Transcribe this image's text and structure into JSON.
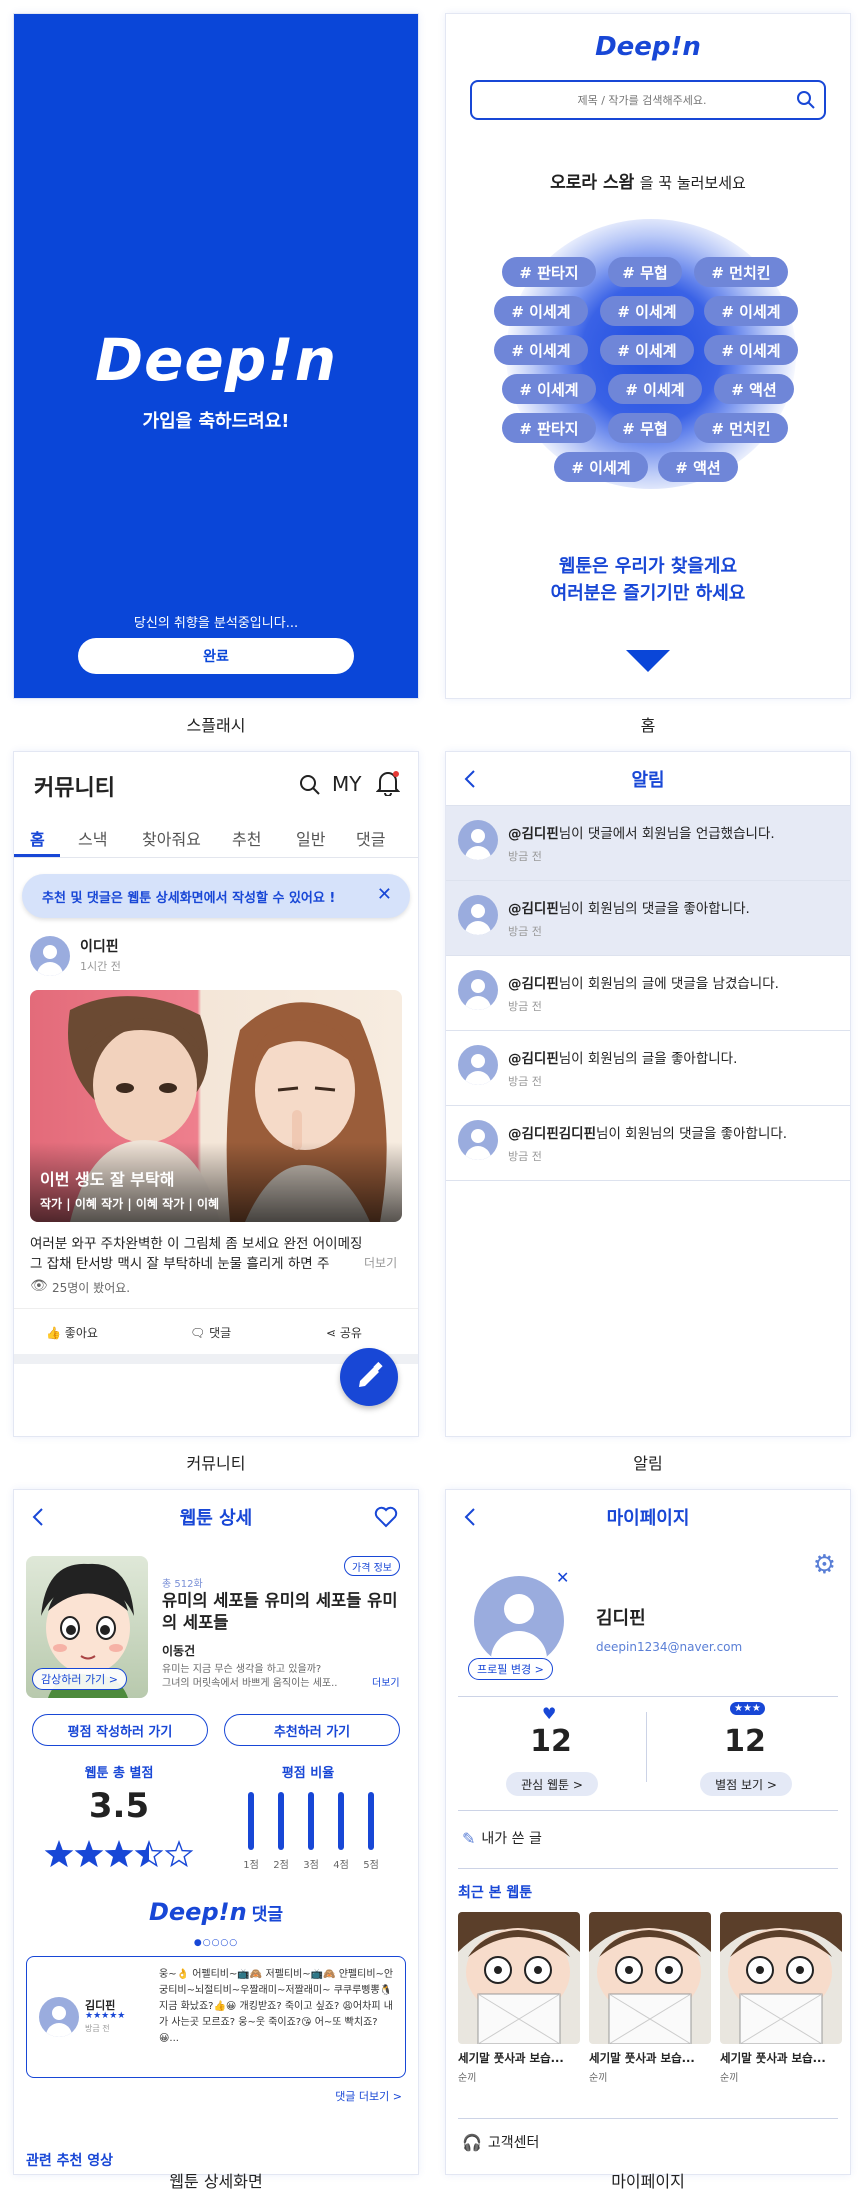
{
  "brand": "Deep!n",
  "splash": {
    "welcome": "가입을 축하드려요!",
    "analyzing": "당신의 취향을 분석중입니다...",
    "done_button": "완료",
    "caption": "스플래시"
  },
  "home": {
    "search_placeholder": "제목 / 작가를 검색해주세요.",
    "prompt_name": "오로라 스왐",
    "prompt_rest": "을 꾹 눌러보세요",
    "tags": [
      "# 판타지",
      "# 무협",
      "# 먼치킨",
      "# 이세계",
      "# 이세계",
      "# 이세계",
      "# 이세계",
      "# 이세계",
      "# 이세계",
      "# 이세계",
      "# 이세계",
      "# 액션",
      "# 판타지",
      "# 무협",
      "# 먼치킨",
      "# 이세계",
      "# 액션"
    ],
    "slogan1": "웹툰은 우리가 찾을게요",
    "slogan2": "여러분은 즐기기만 하세요",
    "caption": "홈"
  },
  "community": {
    "title": "커뮤니티",
    "my": "MY",
    "tabs": [
      "홈",
      "스낵",
      "찾아줘요",
      "추천",
      "일반",
      "댓글"
    ],
    "notice": "추천 및 댓글은 웹툰 상세화면에서 작성할 수 있어요 !",
    "post": {
      "author": "이디핀",
      "time": "1시간 전",
      "image_title": "이번 생도 잘 부탁해",
      "image_meta": "작가 | 이혜  작가 | 이혜  작가 | 이혜",
      "body1": "여러분 와꾸 주차완벽한 이 그림체 좀 보세요 완전 어이메징",
      "body2": "그 잡채 탄서방 맥시 잘 부탁하네 눈물 흘리게 하면 주",
      "more": "더보기",
      "views": "25명이 봤어요."
    },
    "actions": {
      "like": "좋아요",
      "comment": "댓글",
      "share": "공유"
    },
    "caption": "커뮤니티"
  },
  "alarm": {
    "title": "알림",
    "items": [
      {
        "name": "@김디핀",
        "text": "님이 댓글에서 회원님을 언급했습니다.",
        "time": "방금 전",
        "highlight": true
      },
      {
        "name": "@김디핀",
        "text": "님이 회원님의 댓글을 좋아합니다.",
        "time": "방금 전",
        "highlight": true
      },
      {
        "name": "@김디핀",
        "text": "님이 회원님의 글에 댓글을 남겼습니다.",
        "time": "방금 전",
        "highlight": false
      },
      {
        "name": "@김디핀",
        "text": "님이 회원님의 글을 좋아합니다.",
        "time": "방금 전",
        "highlight": false
      },
      {
        "name": "@김디핀김디핀",
        "text": "님이 회원님의 댓글을 좋아합니다.",
        "time": "방금 전",
        "highlight": false
      }
    ],
    "caption": "알림"
  },
  "detail": {
    "title": "웹툰 상세",
    "price_info": "가격 정보",
    "episodes": "총 512화",
    "webtoon_title": "유미의 세포들 유미의 세포들 유미의 세포들",
    "author": "이동건",
    "desc1": "유미는 지금 무슨 생각을 하고 있을까?",
    "desc2": "그녀의 머릿속에서 바쁘게 움직이는 세포..",
    "more": "더보기",
    "go_view": "감상하러 가기 >",
    "rate_button": "평점 작성하러 가기",
    "recommend_button": "추천하러 가기",
    "total_rating_label": "웹툰 총 별점",
    "rating": "3.5",
    "rating_value": 3.5,
    "ratio_label": "평점 비율",
    "ratio_labels": [
      "1점",
      "2점",
      "3점",
      "4점",
      "5점"
    ],
    "comments_title": "댓글",
    "comment": {
      "name": "김디핀",
      "time": "방금 전",
      "text": "웅~👌 어펠티비~📺🙈 저펠티비~📺🙈 얀펠티비~안궁티비~뇌절티비~우짤래미~저짤래미~ 쿠쿠루삥뽕🐧 지금 화났죠?👍😀 개킹받죠? 죽이고 싶죠? 😩어차피 내가 사는곳 모르죠? 웅~웃 죽이죠?😘 어~또 빡치죠? 😀..."
    },
    "comments_more": "댓글 더보기 >",
    "related": "관련 추천 영상",
    "caption": "웹툰 상세화면"
  },
  "mypage": {
    "title": "마이페이지",
    "name": "김디핀",
    "email": "deepin1234@naver.com",
    "edit_profile": "프로필 변경 >",
    "interest_count": "12",
    "interest_label": "관심 웹툰 >",
    "rating_count": "12",
    "rating_label": "별점 보기 >",
    "my_posts": "내가 쓴 글",
    "recent": "최근 본 웹툰",
    "recent_items": [
      {
        "title": "세기말 풋사과 보습...",
        "author": "순끼"
      },
      {
        "title": "세기말 풋사과 보습...",
        "author": "순끼"
      },
      {
        "title": "세기말 풋사과 보습...",
        "author": "순끼"
      }
    ],
    "support": "고객센터",
    "caption": "마이페이지"
  },
  "colors": {
    "brand_blue": "#0a46d8",
    "accent": "#1847d6",
    "tag": "#6f86d8"
  }
}
